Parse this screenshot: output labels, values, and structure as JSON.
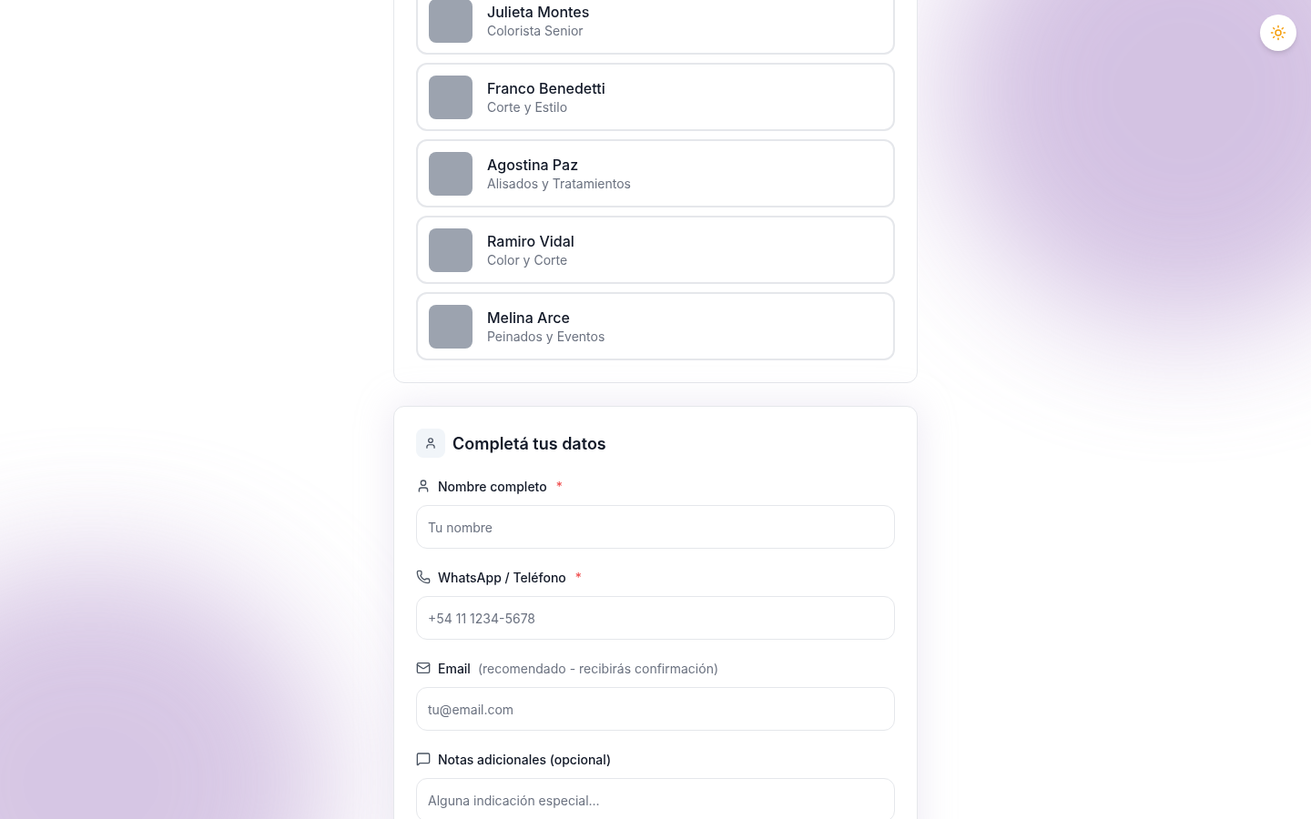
{
  "stylists": [
    {
      "name": "Julieta Montes",
      "specialty": "Colorista Senior"
    },
    {
      "name": "Franco Benedetti",
      "specialty": "Corte y Estilo"
    },
    {
      "name": "Agostina Paz",
      "specialty": "Alisados y Tratamientos"
    },
    {
      "name": "Ramiro Vidal",
      "specialty": "Color y Corte"
    },
    {
      "name": "Melina Arce",
      "specialty": "Peinados y Eventos"
    }
  ],
  "form": {
    "title": "Completá tus datos",
    "fields": [
      {
        "kind": "name",
        "label": "Nombre completo",
        "required_mark": "*",
        "placeholder": "Tu nombre"
      },
      {
        "kind": "phone",
        "label": "WhatsApp / Teléfono",
        "required_mark": "*",
        "placeholder": "+54 11 1234-5678"
      },
      {
        "kind": "email",
        "label": "Email",
        "hint": "(recomendado - recibirás confirmación)",
        "placeholder": "tu@email.com"
      },
      {
        "kind": "notes",
        "label": "Notas adicionales (opcional)",
        "placeholder": "Alguna indicación especial..."
      }
    ]
  }
}
